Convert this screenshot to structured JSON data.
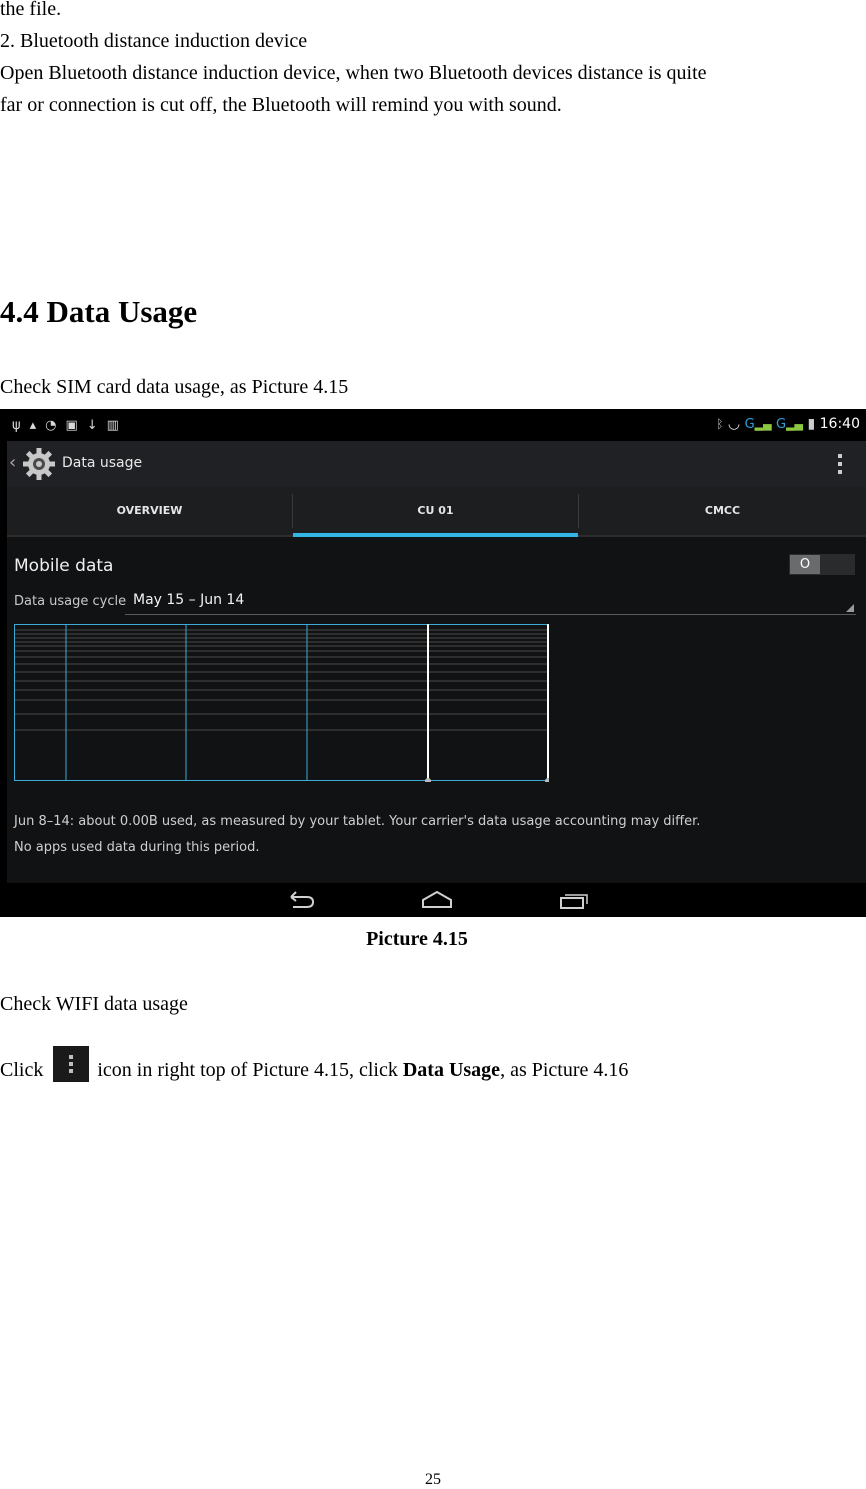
{
  "doc": {
    "line1": "the file.",
    "line2": "2. Bluetooth distance induction device",
    "line3": "Open Bluetooth distance induction device, when two Bluetooth devices distance is quite",
    "line4": "far or connection is cut off, the Bluetooth will remind you with sound.",
    "section_title": "4.4 Data Usage",
    "intro": "Check SIM card data usage, as Picture 4.15",
    "caption": "Picture 4.15",
    "wifi_heading": "Check WIFI data usage",
    "click_word": "Click",
    "instr_mid": "icon in right top of Picture 4.15, click",
    "instr_bold": "Data Usage",
    "instr_end": ", as Picture 4.16",
    "inline_icon": "overflow-menu-icon",
    "page_number": "25"
  },
  "screenshot": {
    "status_bar": {
      "left_icons": [
        "usb-icon",
        "lock-icon",
        "sync-icon",
        "screenshot-icon",
        "download-icon",
        "sd-card-icon"
      ],
      "right_icons": [
        "bluetooth-icon",
        "wifi-icon",
        "signal-icon",
        "signal-icon",
        "battery-icon"
      ],
      "network_1": "G",
      "network_2": "G",
      "time": "16:40"
    },
    "action_bar": {
      "title": "Data usage",
      "back_icon": "chevron-left-icon",
      "app_icon": "gear-icon",
      "menu_icon": "overflow-menu-icon"
    },
    "tabs": [
      {
        "label": "OVERVIEW",
        "active": false
      },
      {
        "label": "CU 01",
        "active": true
      },
      {
        "label": "CMCC",
        "active": false
      }
    ],
    "mobile_data": {
      "label": "Mobile data",
      "toggle_state": "O"
    },
    "cycle": {
      "label": "Data usage cycle",
      "value": "May 15 – Jun 14"
    },
    "chart_note": "Jun 8–14: about 0.00B used, as measured by your tablet. Your carrier's data usage accounting may differ.",
    "apps_note": "No apps used data during this period.",
    "nav_buttons": [
      "back-icon",
      "home-icon",
      "recent-apps-icon"
    ],
    "colors": {
      "accent": "#33b5e5",
      "background": "#111214",
      "action_bar": "#202124"
    }
  }
}
